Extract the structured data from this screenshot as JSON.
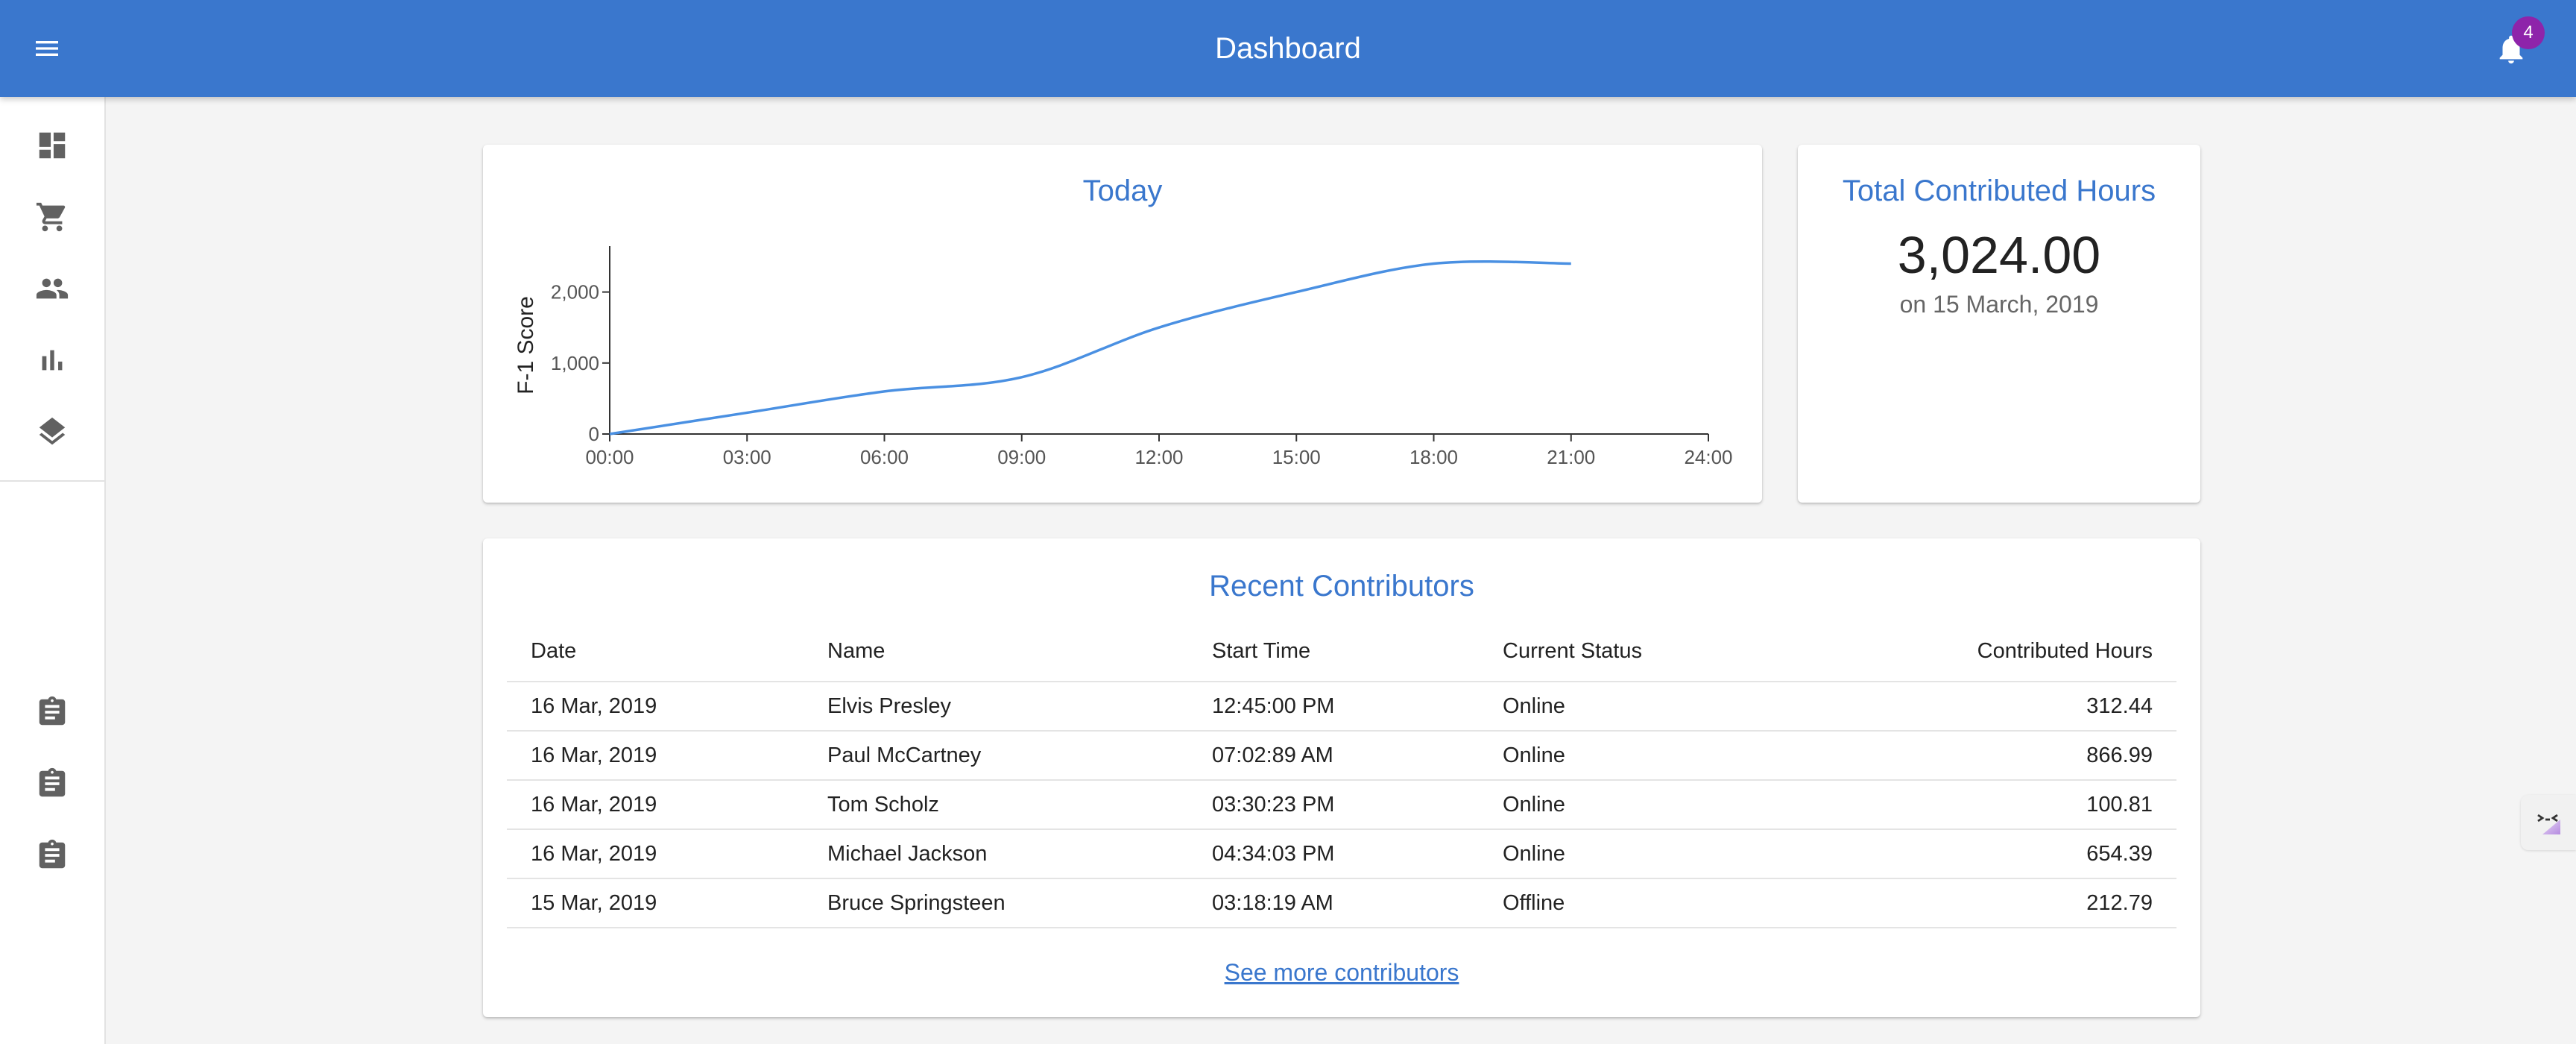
{
  "app_bar": {
    "title": "Dashboard",
    "menu_icon": "menu-icon",
    "notifications_icon": "bell-icon",
    "notification_count": "4",
    "background_color": "#3a77cd",
    "badge_color": "#8e24aa"
  },
  "sidebar": {
    "items": [
      {
        "icon": "dashboard-icon"
      },
      {
        "icon": "shopping-cart-icon"
      },
      {
        "icon": "people-icon"
      },
      {
        "icon": "bar-chart-icon"
      },
      {
        "icon": "layers-icon"
      },
      {
        "icon": "assignment-icon"
      },
      {
        "icon": "assignment-icon"
      },
      {
        "icon": "assignment-icon"
      }
    ]
  },
  "today_card": {
    "title": "Today"
  },
  "chart_data": {
    "type": "line",
    "title": "Today",
    "xlabel": "",
    "ylabel": "F-1 Score",
    "x": [
      "00:00",
      "03:00",
      "06:00",
      "09:00",
      "12:00",
      "15:00",
      "18:00",
      "21:00"
    ],
    "x_ticks": [
      "00:00",
      "03:00",
      "06:00",
      "09:00",
      "12:00",
      "15:00",
      "18:00",
      "21:00",
      "24:00"
    ],
    "y_ticks": [
      "0",
      "1,000",
      "2,000"
    ],
    "series": [
      {
        "values": [
          0,
          300,
          600,
          800,
          1500,
          2000,
          2400,
          2400
        ],
        "color": "#4a90e2"
      }
    ],
    "xlim": [
      0,
      24
    ],
    "ylim": [
      0,
      2500
    ],
    "grid": false,
    "legend": "none"
  },
  "total_card": {
    "title": "Total Contributed Hours",
    "value": "3,024.00",
    "date": "on 15 March, 2019"
  },
  "contributors": {
    "title": "Recent Contributors",
    "headers": {
      "date": "Date",
      "name": "Name",
      "start_time": "Start Time",
      "status": "Current Status",
      "hours": "Contributed Hours"
    },
    "rows": [
      {
        "date": "16 Mar, 2019",
        "name": "Elvis Presley",
        "start_time": "12:45:00 PM",
        "status": "Online",
        "hours": "312.44"
      },
      {
        "date": "16 Mar, 2019",
        "name": "Paul McCartney",
        "start_time": "07:02:89 AM",
        "status": "Online",
        "hours": "866.99"
      },
      {
        "date": "16 Mar, 2019",
        "name": "Tom Scholz",
        "start_time": "03:30:23 PM",
        "status": "Online",
        "hours": "100.81"
      },
      {
        "date": "16 Mar, 2019",
        "name": "Michael Jackson",
        "start_time": "04:34:03 PM",
        "status": "Online",
        "hours": "654.39"
      },
      {
        "date": "15 Mar, 2019",
        "name": "Bruce Springsteen",
        "start_time": "03:18:19 AM",
        "status": "Offline",
        "hours": "212.79"
      }
    ],
    "see_more_label": "See more contributors"
  },
  "floating_widget": {
    "icon": "chat-face-icon"
  }
}
